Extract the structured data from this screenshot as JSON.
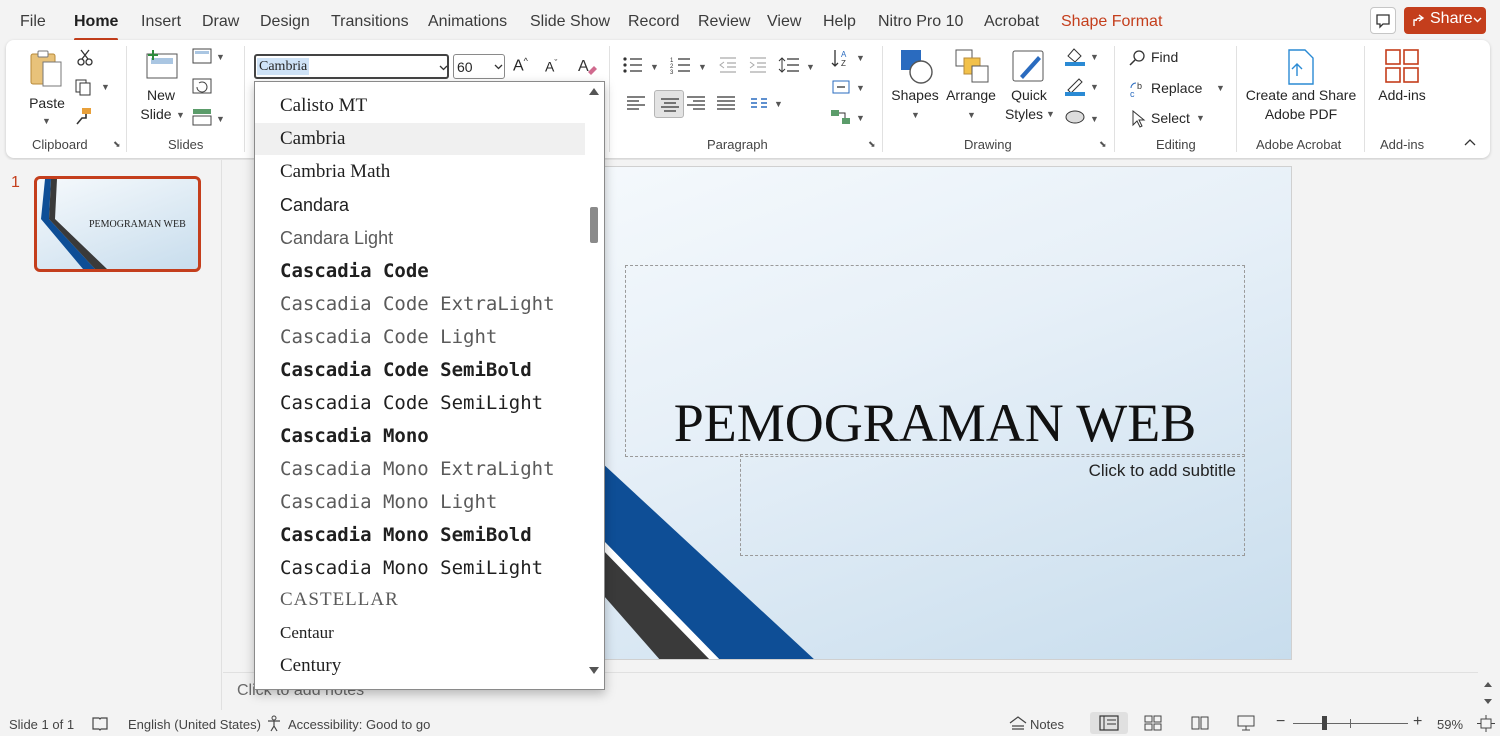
{
  "menu": {
    "tabs": [
      "File",
      "Home",
      "Insert",
      "Draw",
      "Design",
      "Transitions",
      "Animations",
      "Slide Show",
      "Record",
      "Review",
      "View",
      "Help",
      "Nitro Pro 10",
      "Acrobat",
      "Shape Format"
    ],
    "active_tab": "Home",
    "share_label": "Share"
  },
  "ribbon": {
    "clipboard": {
      "paste_label": "Paste",
      "group_label": "Clipboard"
    },
    "slides": {
      "new_slide_label_1": "New",
      "new_slide_label_2": "Slide",
      "group_label": "Slides"
    },
    "font": {
      "name_value": "Cambria",
      "size_value": "60"
    },
    "paragraph": {
      "group_label": "Paragraph"
    },
    "drawing": {
      "shapes_label": "Shapes",
      "arrange_label": "Arrange",
      "quick_styles_label_1": "Quick",
      "quick_styles_label_2": "Styles",
      "group_label": "Drawing"
    },
    "editing": {
      "find_label": "Find",
      "replace_label": "Replace",
      "select_label": "Select",
      "group_label": "Editing"
    },
    "adobe": {
      "create_label_1": "Create and Share",
      "create_label_2": "Adobe PDF",
      "group_label": "Adobe Acrobat"
    },
    "addins": {
      "label": "Add-ins",
      "group_label": "Add-ins"
    }
  },
  "font_dropdown": {
    "items": [
      {
        "label": "Calisto MT",
        "style": "serif"
      },
      {
        "label": "Cambria",
        "style": "serif",
        "highlighted": true
      },
      {
        "label": "Cambria Math",
        "style": "serif"
      },
      {
        "label": "Candara",
        "style": "sans"
      },
      {
        "label": "Candara Light",
        "style": "sans-light"
      },
      {
        "label": "Cascadia Code",
        "style": "mono-bold"
      },
      {
        "label": "Cascadia Code ExtraLight",
        "style": "mono-light"
      },
      {
        "label": "Cascadia Code Light",
        "style": "mono-light"
      },
      {
        "label": "Cascadia Code SemiBold",
        "style": "mono-bold"
      },
      {
        "label": "Cascadia Code SemiLight",
        "style": "mono"
      },
      {
        "label": "Cascadia Mono",
        "style": "mono-bold"
      },
      {
        "label": "Cascadia Mono ExtraLight",
        "style": "mono-light"
      },
      {
        "label": "Cascadia Mono Light",
        "style": "mono-light"
      },
      {
        "label": "Cascadia Mono SemiBold",
        "style": "mono-bold"
      },
      {
        "label": "Cascadia Mono SemiLight",
        "style": "mono"
      },
      {
        "label": "CASTELLAR",
        "style": "serif-light"
      },
      {
        "label": "Centaur",
        "style": "serif"
      },
      {
        "label": "Century",
        "style": "serif"
      }
    ]
  },
  "thumbnails": [
    {
      "number": "1",
      "title": "PEMOGRAMAN WEB"
    }
  ],
  "slide": {
    "title": "PEMOGRAMAN WEB",
    "subtitle_placeholder": "Click to add subtitle"
  },
  "notes_placeholder": "Click to add notes",
  "status": {
    "slide_counter": "Slide 1 of 1",
    "language": "English (United States)",
    "accessibility": "Accessibility: Good to go",
    "notes_label": "Notes",
    "zoom_level": "59%"
  },
  "colors": {
    "accent": "#c43e1c",
    "slide_blue": "#0e4e96",
    "slide_dark": "#3a3a3a"
  }
}
